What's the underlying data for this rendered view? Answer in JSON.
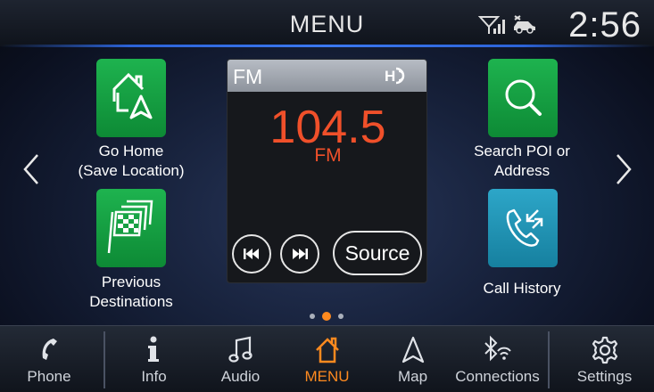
{
  "header": {
    "title": "MENU",
    "time": "2:56"
  },
  "tiles": {
    "go_home": {
      "label": "Go Home\n(Save Location)"
    },
    "previous_destinations": {
      "label": "Previous\nDestinations"
    },
    "search_poi": {
      "label": "Search POI or\nAddress"
    },
    "call_history": {
      "label": "Call History"
    }
  },
  "radio": {
    "band": "FM",
    "frequency": "104.5",
    "unit": "FM",
    "source_label": "Source"
  },
  "pagination": {
    "pages": 3,
    "current": 2
  },
  "bottom_bar": {
    "phone": "Phone",
    "info": "Info",
    "audio": "Audio",
    "menu": "MENU",
    "map": "Map",
    "connections": "Connections",
    "settings": "Settings"
  },
  "colors": {
    "accent": "#ff8a1f",
    "frequency": "#f0502a",
    "tile_green": "#1eb34f",
    "tile_blue": "#2da6c8"
  }
}
